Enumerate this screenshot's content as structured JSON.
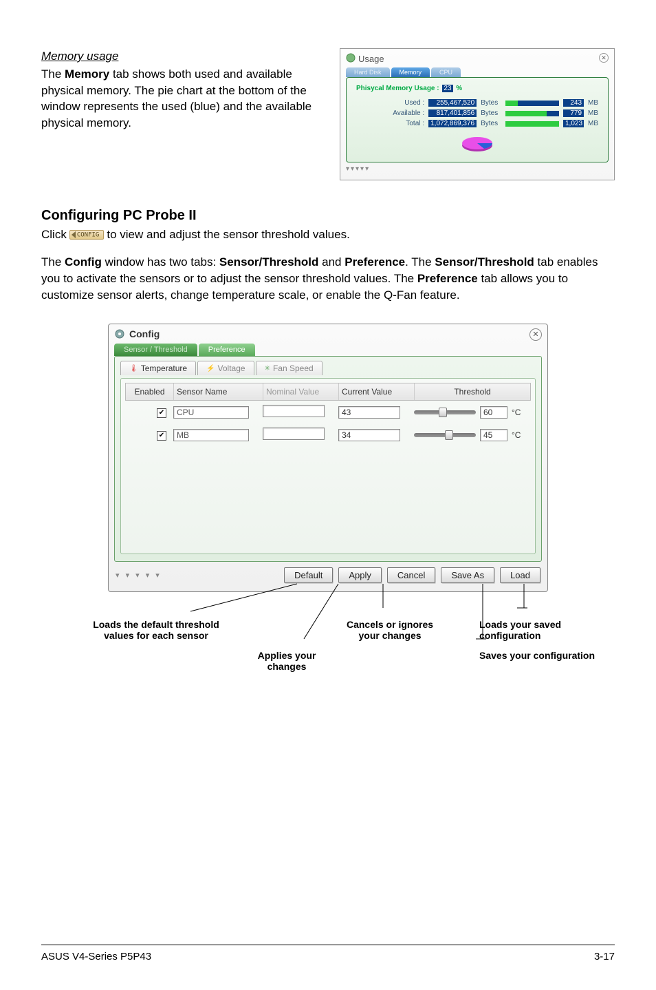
{
  "memory": {
    "heading": "Memory usage",
    "body_prefix": "The ",
    "body_bold": "Memory",
    "body_suffix": " tab shows both used and available physical memory. The pie chart at the bottom of the window represents the used (blue) and the available physical memory."
  },
  "usage_window": {
    "title": "Usage",
    "tabs": {
      "hard": "Hard Disk",
      "memory": "Memory",
      "cpu": "CPU"
    },
    "pm_label": "Phisycal Memory Usage :",
    "pm_percent": "23",
    "pm_pct_sign": "%",
    "rows": {
      "used": {
        "label": "Used :",
        "bytes": "255,467,520",
        "bytes_lit": "Bytes",
        "mb": "243",
        "mb_lit": "MB",
        "pct": 23
      },
      "avail": {
        "label": "Available :",
        "bytes": "817,401,856",
        "bytes_lit": "Bytes",
        "mb": "779",
        "mb_lit": "MB",
        "pct": 77
      },
      "total": {
        "label": "Total :",
        "bytes": "1,072,869,376",
        "bytes_lit": "Bytes",
        "mb": "1,023",
        "mb_lit": "MB",
        "pct": 100
      }
    }
  },
  "config_heading": "Configuring PC Probe II",
  "click_line": {
    "prefix": "Click ",
    "btn": "CONFIG",
    "suffix": " to view and adjust the sensor threshold values."
  },
  "para": {
    "p1a": "The ",
    "p1b": "Config",
    "p1c": " window has two tabs: ",
    "p1d": "Sensor/Threshold",
    "p1e": " and ",
    "p1f": "Preference",
    "p1g": ". The ",
    "p2a": "Sensor/Threshold",
    "p2b": " tab enables you to activate the sensors or to adjust the sensor threshold values. The ",
    "p2c": "Preference",
    "p2d": " tab allows you to customize sensor alerts, change temperature scale, or enable the Q-Fan feature."
  },
  "config_window": {
    "title": "Config",
    "tabs1": {
      "sensor": "Sensor / Threshold",
      "pref": "Preference"
    },
    "tabs2": {
      "temp": "Temperature",
      "volt": "Voltage",
      "fan": "Fan Speed"
    },
    "headers": {
      "enabled": "Enabled",
      "sensor": "Sensor Name",
      "nominal": "Nominal Value",
      "current": "Current Value",
      "threshold": "Threshold"
    },
    "rows": [
      {
        "enabled": true,
        "name": "CPU",
        "nominal": "",
        "current": "43",
        "threshold": "60",
        "unit": "°C",
        "slider_pct": 45
      },
      {
        "enabled": true,
        "name": "MB",
        "nominal": "",
        "current": "34",
        "threshold": "45",
        "unit": "°C",
        "slider_pct": 55
      }
    ],
    "buttons": {
      "default": "Default",
      "apply": "Apply",
      "cancel": "Cancel",
      "saveas": "Save As",
      "load": "Load"
    }
  },
  "annotations": {
    "default": "Loads the default threshold values for each sensor",
    "apply": "Applies your changes",
    "cancel": "Cancels or ignores your changes",
    "load": "Loads your saved configuration",
    "save": "Saves your configuration"
  },
  "footer": {
    "left": "ASUS V4-Series P5P43",
    "right": "3-17"
  }
}
